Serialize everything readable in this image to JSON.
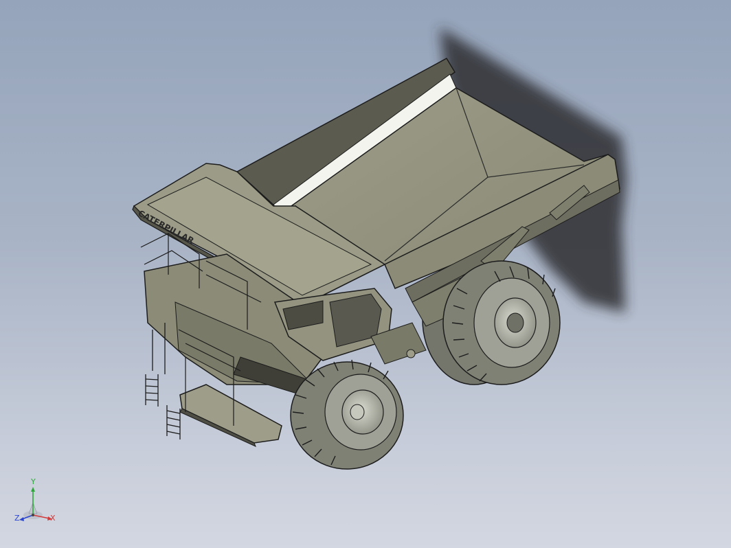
{
  "model": {
    "name": "mining haul truck 3D CAD model",
    "brand_text": "CATERPILLAR",
    "colors": {
      "body": "#8b8b78",
      "body_dark": "#56564a",
      "body_light": "#a7a792",
      "tire": "#7f8175",
      "shadow": "#2d2f33",
      "outline": "#1c1c1c"
    }
  },
  "triad": {
    "x_label": "X",
    "y_label": "Y",
    "z_label": "Z",
    "colors": {
      "x": "#d23a3a",
      "y": "#2ea63a",
      "z": "#2a45d0"
    }
  }
}
